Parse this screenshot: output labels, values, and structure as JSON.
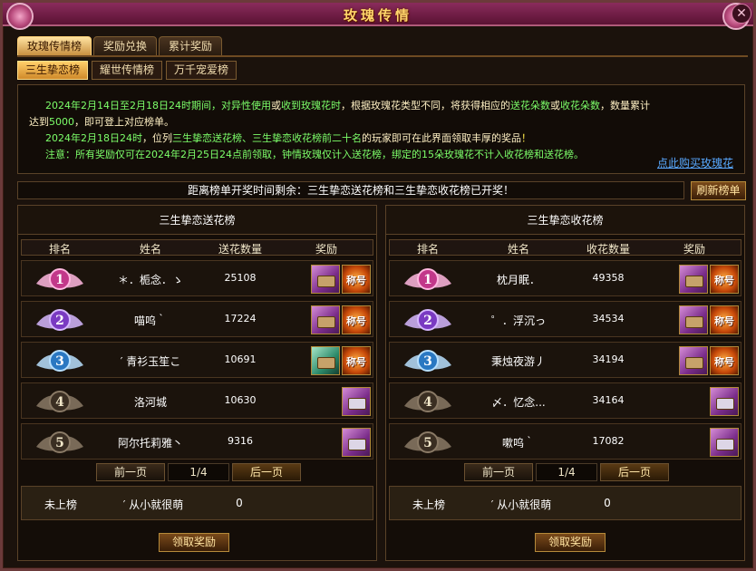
{
  "window": {
    "title": "玫瑰传情",
    "close_label": "✕"
  },
  "main_tabs": [
    {
      "label": "玫瑰传情榜",
      "active": true
    },
    {
      "label": "奖励兑换",
      "active": false
    },
    {
      "label": "累计奖励",
      "active": false
    }
  ],
  "sub_tabs": [
    {
      "label": "三生挚恋榜",
      "active": true
    },
    {
      "label": "耀世传情榜",
      "active": false
    },
    {
      "label": "万千宠爱榜",
      "active": false
    }
  ],
  "info": {
    "line1_a": "2024年2月14日至2月18日24时期间，",
    "line1_b": "对异性使用",
    "line1_c": "或",
    "line1_d": "收到玫瑰花时",
    "line1_e": "，根据玫瑰花类型不同，将获得相应的",
    "line1_f": "送花朵数",
    "line1_g": "或",
    "line1_h": "收花朵数",
    "line1_i": "，数量累计",
    "line2_a": "达到",
    "line2_b": "5000",
    "line2_c": "，即可登上对应榜单。",
    "line3_a": "2024年2月18日24时",
    "line3_b": "，位列",
    "line3_c": "三生挚恋送花榜、三生挚恋收花榜",
    "line3_d": "前二十名",
    "line3_e": "的玩家即可在此界面领取丰厚的奖品",
    "line3_f": "！",
    "line4": "注意：所有奖励仅可在2024年2月25日24点前领取，钟情玫瑰仅计入送花榜，绑定的15朵玫瑰花不计入收花榜和送花榜。",
    "buy_link": "点此购买玫瑰花"
  },
  "countdown_text": "距离榜单开奖时间剩余：三生挚恋送花榜和三生挚恋收花榜已开奖！",
  "refresh_label": "刷新榜单",
  "colors": {
    "title_gold": "#ffd66b",
    "green_text": "#7dff6a",
    "link_blue": "#58a8ff"
  },
  "left_panel": {
    "title": "三生挚恋送花榜",
    "headers": [
      "排名",
      "姓名",
      "送花数量",
      "奖励"
    ],
    "rows": [
      {
        "rank": "1",
        "name": "＊．栀念．ゝ",
        "count": "25108",
        "badge": "rank-1-pink",
        "rewards": [
          "chest",
          "buff"
        ]
      },
      {
        "rank": "2",
        "name": "喵呜｀",
        "count": "17224",
        "badge": "rank-2-purple",
        "rewards": [
          "chest",
          "buff"
        ]
      },
      {
        "rank": "3",
        "name": "′ 青衫玉笙こ",
        "count": "10691",
        "badge": "rank-3-blue",
        "rewards": [
          "chest-green",
          "buff"
        ]
      },
      {
        "rank": "4",
        "name": "洛河城",
        "count": "10630",
        "badge": "rank-4-bronze",
        "rewards": [
          "chest-gray"
        ]
      },
      {
        "rank": "5",
        "name": "阿尔托莉雅丶",
        "count": "9316",
        "badge": "rank-5-bronze",
        "rewards": [
          "chest-gray"
        ]
      }
    ],
    "pager": {
      "prev": "前一页",
      "page": "1/4",
      "next": "后一页"
    },
    "mine": {
      "status": "未上榜",
      "name": "′ 从小就很萌",
      "count": "0"
    },
    "claim": "领取奖励",
    "buff_text": "称号"
  },
  "right_panel": {
    "title": "三生挚恋收花榜",
    "headers": [
      "排名",
      "姓名",
      "收花数量",
      "奖励"
    ],
    "rows": [
      {
        "rank": "1",
        "name": "枕月眠．",
        "count": "49358",
        "badge": "rank-1-pink",
        "rewards": [
          "chest",
          "buff"
        ]
      },
      {
        "rank": "2",
        "name": "゜．浮沉っ",
        "count": "34534",
        "badge": "rank-2-purple",
        "rewards": [
          "chest",
          "buff"
        ]
      },
      {
        "rank": "3",
        "name": "秉烛夜游丿",
        "count": "34194",
        "badge": "rank-3-blue",
        "rewards": [
          "chest",
          "buff"
        ]
      },
      {
        "rank": "4",
        "name": "〆．忆念...",
        "count": "34164",
        "badge": "rank-4-bronze",
        "rewards": [
          "chest-gray"
        ]
      },
      {
        "rank": "5",
        "name": "嗽呜｀",
        "count": "17082",
        "badge": "rank-5-bronze",
        "rewards": [
          "chest-gray"
        ]
      }
    ],
    "pager": {
      "prev": "前一页",
      "page": "1/4",
      "next": "后一页"
    },
    "mine": {
      "status": "未上榜",
      "name": "′ 从小就很萌",
      "count": "0"
    },
    "claim": "领取奖励",
    "buff_text": "称号"
  }
}
